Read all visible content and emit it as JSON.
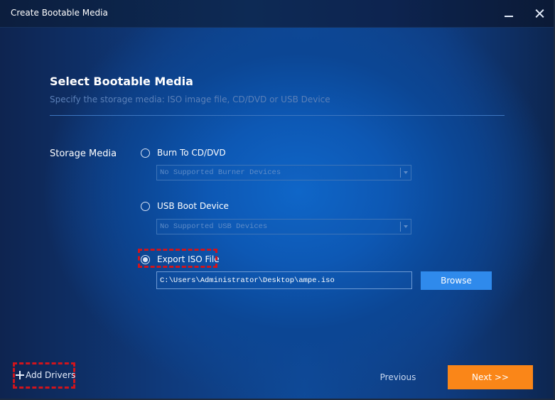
{
  "window": {
    "title": "Create Bootable Media",
    "controls": {
      "minimize_icon": "minimize-icon",
      "close_icon": "close-icon"
    }
  },
  "header": {
    "title": "Select Bootable Media",
    "subtitle": "Specify the storage media: ISO image file, CD/DVD or USB Device"
  },
  "storage": {
    "label": "Storage Media",
    "options": [
      {
        "label": "Burn To CD/DVD",
        "selected": false,
        "device_select": "No Supported Burner Devices"
      },
      {
        "label": "USB Boot Device",
        "selected": false,
        "device_select": "No Supported USB Devices"
      },
      {
        "label": "Export ISO File",
        "selected": true,
        "path_value": "C:\\Users\\Administrator\\Desktop\\ampe.iso"
      }
    ],
    "browse_label": "Browse"
  },
  "footer": {
    "add_drivers_label": "Add Drivers",
    "add_drivers_icon": "plus-icon",
    "previous_label": "Previous",
    "next_label": "Next >>"
  },
  "colors": {
    "accent_orange": "#fa8618",
    "browse_blue": "#2f8aec",
    "highlight_red": "#d0141c"
  }
}
